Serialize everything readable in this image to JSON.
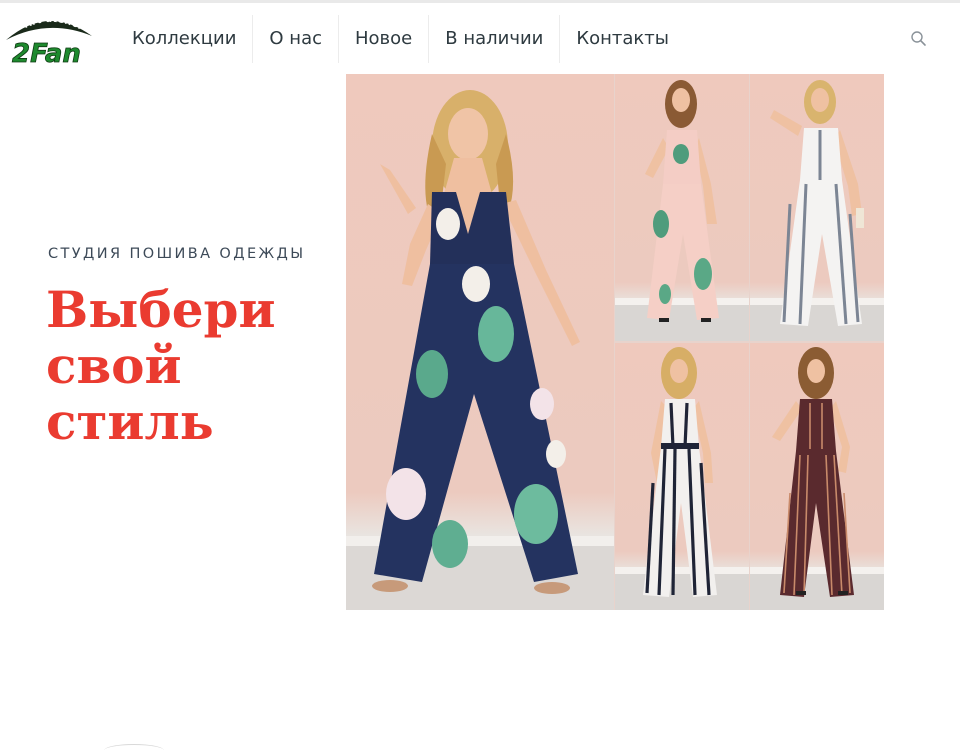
{
  "brand": {
    "arc_text": "Art atelier",
    "name": "2Fan"
  },
  "nav": {
    "items": [
      "Коллекции",
      "О нас",
      "Новое",
      "В наличии",
      "Контакты"
    ],
    "search_icon": "search-icon"
  },
  "hero": {
    "subtitle": "СТУДИЯ ПОШИВА ОДЕЖДЫ",
    "headline_lines": [
      "Выбери",
      "свой",
      "стиль"
    ]
  },
  "colors": {
    "accent": "#ea3b30",
    "nav_text": "#2e3a40",
    "subtitle_text": "#3d4a58",
    "logo_green": "#1e8a2e",
    "logo_dark": "#1a2a1a"
  },
  "collage": {
    "photos": [
      {
        "name": "navy-floral-jumpsuit-photo"
      },
      {
        "name": "pink-floral-jumpsuit-photo"
      },
      {
        "name": "white-striped-jumpsuit-photo"
      },
      {
        "name": "black-white-striped-jumpsuit-photo"
      },
      {
        "name": "burgundy-striped-jumpsuit-photo"
      }
    ]
  }
}
